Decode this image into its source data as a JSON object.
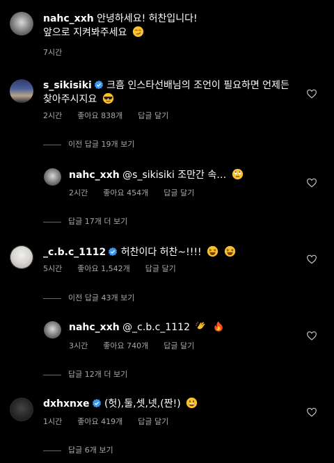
{
  "comments": [
    {
      "username": "nahc_xxh",
      "text_line1": "안녕하세요! 허찬입니다!",
      "text_line2": "앞으로 지켜봐주세요",
      "emoji": "smirk-emoji",
      "time": "7시간"
    },
    {
      "username": "s_sikisiki",
      "verified": true,
      "text_line1": "크흠 인스타선배님의 조언이 필요하면 언제든",
      "text_line2": "찾아주시지요",
      "emoji": "sunglasses-emoji",
      "time": "2시간",
      "likes": "좋아요 838개",
      "reply_action": "답글 달기",
      "view_prev_replies": "이전 답글 19개 보기",
      "reply": {
        "username": "nahc_xxh",
        "text": "@s_sikisiki 조만간 속…",
        "emoji": "rolling-eyes-emoji",
        "time": "2시간",
        "likes": "좋아요 454개",
        "reply_action": "답글 달기"
      },
      "view_more_replies": "답글 17개 더 보기"
    },
    {
      "username": "_c.b.c_1112",
      "verified": true,
      "text_line1": "허찬이다 허찬~!!!!",
      "emoji": "laughing-emoji",
      "time": "5시간",
      "likes": "좋아요 1,542개",
      "reply_action": "답글 달기",
      "view_prev_replies": "이전 답글 43개 보기",
      "reply": {
        "username": "nahc_xxh",
        "text": "@_c.b.c_1112",
        "emoji": "clap-fire-emoji",
        "time": "3시간",
        "likes": "좋아요 740개",
        "reply_action": "답글 달기"
      },
      "view_more_replies": "답글 12개 더 보기"
    },
    {
      "username": "dxhxnxe",
      "verified": true,
      "text_line1": "(헛),둘,셋,넷,(짠!)",
      "emoji": "grin-emoji",
      "time": "1시간",
      "likes": "좋아요 419개",
      "reply_action": "답글 달기",
      "view_more_replies": "답글 6개 보기"
    }
  ],
  "colors": {
    "verified": "#3897f0",
    "meta": "#a8a8a8",
    "background": "#000000"
  }
}
